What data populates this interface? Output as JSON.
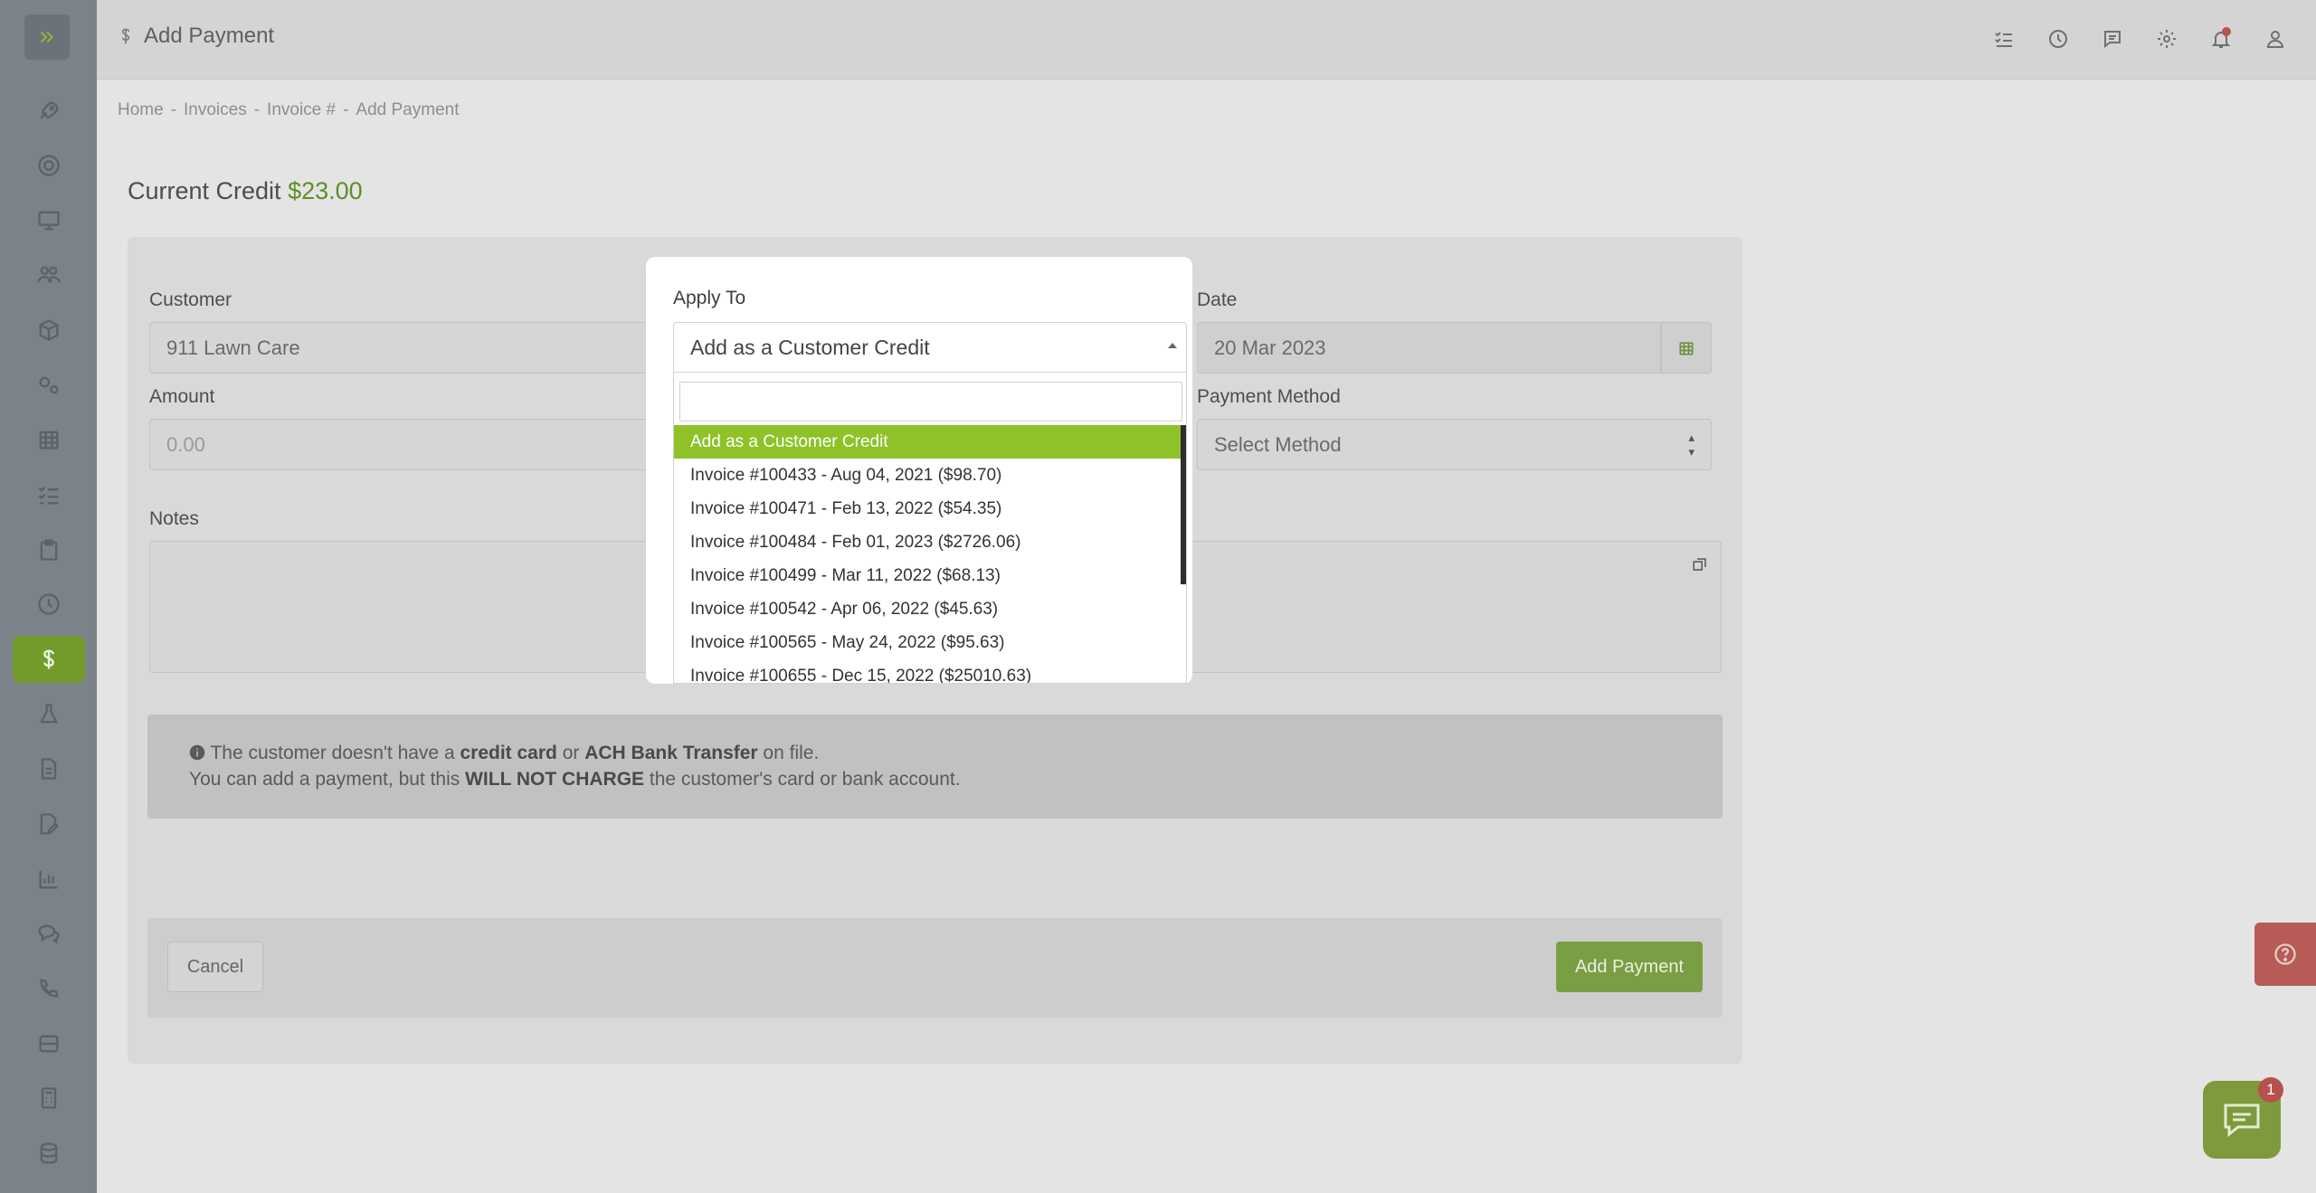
{
  "header": {
    "title": "Add Payment"
  },
  "breadcrumb": [
    "Home",
    "-",
    "Invoices",
    "-",
    "Invoice #",
    "-",
    "Add Payment"
  ],
  "credit": {
    "label": "Current Credit",
    "amount": "$23.00"
  },
  "form": {
    "customer_label": "Customer",
    "customer_value": "911 Lawn Care",
    "amount_label": "Amount",
    "amount_placeholder": "0.00",
    "date_label": "Date",
    "date_value": "20 Mar 2023",
    "payment_method_label": "Payment Method",
    "payment_method_placeholder": "Select Method",
    "notes_label": "Notes"
  },
  "notice": {
    "line1_a": "The customer doesn't have a ",
    "line1_b": "credit card",
    "line1_c": " or ",
    "line1_d": "ACH Bank Transfer",
    "line1_e": " on file.",
    "line2_a": "You can add a payment, but this ",
    "line2_b": "WILL NOT CHARGE",
    "line2_c": " the customer's card or bank account."
  },
  "buttons": {
    "cancel": "Cancel",
    "add_payment": "Add Payment"
  },
  "modal": {
    "label": "Apply To",
    "selected": "Add as a Customer Credit",
    "options": [
      "Add as a Customer Credit",
      "Invoice #100433 - Aug 04, 2021 ($98.70)",
      "Invoice #100471 - Feb 13, 2022 ($54.35)",
      "Invoice #100484 - Feb 01, 2023 ($2726.06)",
      "Invoice #100499 - Mar 11, 2022 ($68.13)",
      "Invoice #100542 - Apr 06, 2022 ($45.63)",
      "Invoice #100565 - May 24, 2022 ($95.63)",
      "Invoice #100655 - Dec 15, 2022 ($25010.63)"
    ]
  },
  "chat": {
    "badge": "1"
  },
  "colors": {
    "accent": "#8ec228",
    "credit_green": "#5d8e28",
    "danger": "#b75b57"
  }
}
